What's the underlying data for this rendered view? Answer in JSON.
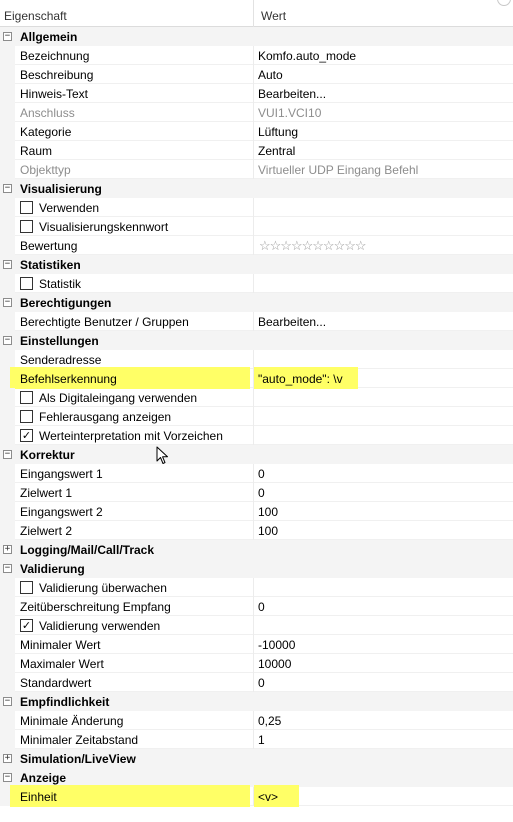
{
  "header": {
    "col_property": "Eigenschaft",
    "col_value": "Wert"
  },
  "sections": {
    "allgemein": {
      "title": "Allgemein",
      "toggle": "−",
      "bezeichnung": {
        "name": "Bezeichnung",
        "value": "Komfo.auto_mode"
      },
      "beschreibung": {
        "name": "Beschreibung",
        "value": "Auto"
      },
      "hinweis": {
        "name": "Hinweis-Text",
        "value": "Bearbeiten..."
      },
      "anschluss": {
        "name": "Anschluss",
        "value": "VUI1.VCI10"
      },
      "kategorie": {
        "name": "Kategorie",
        "value": "Lüftung"
      },
      "raum": {
        "name": "Raum",
        "value": "Zentral"
      },
      "objekttyp": {
        "name": "Objekttyp",
        "value": "Virtueller UDP Eingang Befehl"
      }
    },
    "visualisierung": {
      "title": "Visualisierung",
      "toggle": "−",
      "verwenden": {
        "name": "Verwenden",
        "checked": false
      },
      "kennwort": {
        "name": "Visualisierungskennwort",
        "checked": false
      },
      "bewertung": {
        "name": "Bewertung",
        "stars": "☆☆☆☆☆☆☆☆☆☆",
        "rating": 0
      }
    },
    "statistiken": {
      "title": "Statistiken",
      "toggle": "−",
      "statistik": {
        "name": "Statistik",
        "checked": false
      }
    },
    "berechtigungen": {
      "title": "Berechtigungen",
      "toggle": "−",
      "benutzer": {
        "name": "Berechtigte Benutzer / Gruppen",
        "value": "Bearbeiten..."
      }
    },
    "einstellungen": {
      "title": "Einstellungen",
      "toggle": "−",
      "senderadresse": {
        "name": "Senderadresse",
        "value": ""
      },
      "befehlserkennung": {
        "name": "Befehlserkennung",
        "value": "\"auto_mode\": \\v"
      },
      "digitaleingang": {
        "name": "Als Digitaleingang verwenden",
        "checked": false
      },
      "fehlerausgang": {
        "name": "Fehlerausgang anzeigen",
        "checked": false
      },
      "werteinterpretation": {
        "name": "Werteinterpretation mit Vorzeichen",
        "checked": true,
        "mark": "✓"
      }
    },
    "korrektur": {
      "title": "Korrektur",
      "toggle": "−",
      "eingangswert1": {
        "name": "Eingangswert 1",
        "value": "0"
      },
      "zielwert1": {
        "name": "Zielwert 1",
        "value": "0"
      },
      "eingangswert2": {
        "name": "Eingangswert 2",
        "value": "100"
      },
      "zielwert2": {
        "name": "Zielwert 2",
        "value": "100"
      }
    },
    "logging": {
      "title": "Logging/Mail/Call/Track",
      "toggle": "+"
    },
    "validierung": {
      "title": "Validierung",
      "toggle": "−",
      "ueberwachen": {
        "name": "Validierung überwachen",
        "checked": false
      },
      "zeitueberschreitung": {
        "name": "Zeitüberschreitung Empfang",
        "value": "0"
      },
      "verwenden": {
        "name": "Validierung verwenden",
        "checked": true,
        "mark": "✓"
      },
      "minimal": {
        "name": "Minimaler Wert",
        "value": "-10000"
      },
      "maximal": {
        "name": "Maximaler Wert",
        "value": "10000"
      },
      "standard": {
        "name": "Standardwert",
        "value": "0"
      }
    },
    "empfindlichkeit": {
      "title": "Empfindlichkeit",
      "toggle": "−",
      "aenderung": {
        "name": "Minimale Änderung",
        "value": "0,25"
      },
      "zeitabstand": {
        "name": "Minimaler Zeitabstand",
        "value": "1"
      }
    },
    "simulation": {
      "title": "Simulation/LiveView",
      "toggle": "+"
    },
    "anzeige": {
      "title": "Anzeige",
      "toggle": "−",
      "einheit": {
        "name": "Einheit",
        "value": "<v>"
      }
    }
  },
  "colors": {
    "highlight": "#ffff66",
    "disabled_text": "#8d8d8d",
    "gutter": "#f4f4f4"
  }
}
